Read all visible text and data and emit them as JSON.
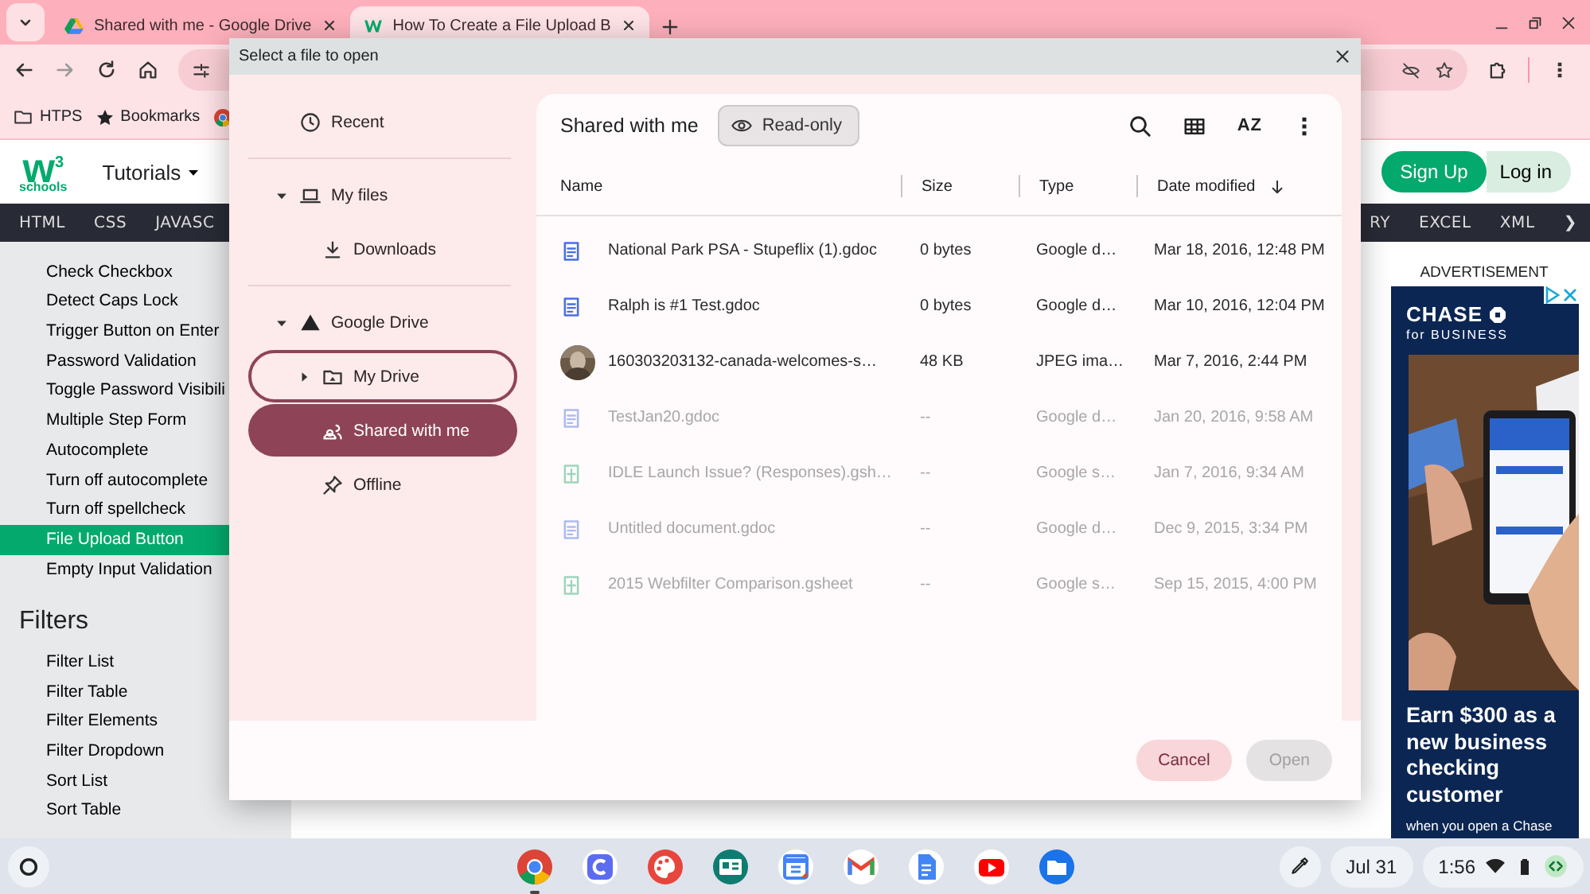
{
  "browser": {
    "tabs": [
      {
        "title": "Shared with me - Google Drive",
        "selected": false,
        "kind": "drive"
      },
      {
        "title": "How To Create a File Upload B",
        "selected": true,
        "kind": "w3"
      }
    ],
    "bookmarks": [
      {
        "label": "HTPS",
        "kind": "folder"
      },
      {
        "label": "Bookmarks",
        "kind": "star"
      }
    ]
  },
  "site": {
    "logo": {
      "mark": "w",
      "sup": "3",
      "text": "schools"
    },
    "menu": "Tutorials",
    "sign_up": "Sign Up",
    "log_in": "Log in",
    "nav_left": [
      "HTML",
      "CSS",
      "JAVASC"
    ],
    "nav_right": [
      "RY",
      "EXCEL",
      "XML",
      "❯"
    ],
    "sidebar": [
      {
        "label": "Check Checkbox",
        "selected": false
      },
      {
        "label": "Detect Caps Lock",
        "selected": false
      },
      {
        "label": "Trigger Button on Enter",
        "selected": false
      },
      {
        "label": "Password Validation",
        "selected": false
      },
      {
        "label": "Toggle Password Visibili",
        "selected": false
      },
      {
        "label": "Multiple Step Form",
        "selected": false
      },
      {
        "label": "Autocomplete",
        "selected": false
      },
      {
        "label": "Turn off autocomplete",
        "selected": false
      },
      {
        "label": "Turn off spellcheck",
        "selected": false
      },
      {
        "label": "File Upload Button",
        "selected": true
      },
      {
        "label": "Empty Input Validation",
        "selected": false
      }
    ],
    "filters": {
      "title": "Filters",
      "items": [
        {
          "label": "Filter List",
          "selected": false
        },
        {
          "label": "Filter Table",
          "selected": false
        },
        {
          "label": "Filter Elements",
          "selected": false
        },
        {
          "label": "Filter Dropdown",
          "selected": false
        },
        {
          "label": "Sort List",
          "selected": false
        },
        {
          "label": "Sort Table",
          "selected": false
        }
      ]
    },
    "ad": {
      "label": "ADVERTISEMENT",
      "brand": "CHASE",
      "sub": "for BUSINESS",
      "headline": "Earn $300 as a new business checking customer",
      "note": "when you open a Chase"
    }
  },
  "dialog": {
    "title": "Select a file to open",
    "nav": [
      {
        "label": "Recent",
        "kind": "recent",
        "selected": false,
        "focused": false
      },
      {
        "label": "My files",
        "kind": "device",
        "selected": false,
        "focused": false,
        "expanded": true,
        "children": [
          {
            "label": "Downloads",
            "kind": "downloads",
            "selected": false,
            "focused": false
          }
        ]
      },
      {
        "label": "Google Drive",
        "kind": "drive",
        "selected": false,
        "focused": false,
        "expanded": true,
        "children": [
          {
            "label": "My Drive",
            "kind": "my-drive",
            "selected": false,
            "focused": true,
            "expanded": false
          },
          {
            "label": "Shared with me",
            "kind": "shared",
            "selected": true,
            "focused": false
          },
          {
            "label": "Offline",
            "kind": "offline",
            "selected": false,
            "focused": false
          }
        ]
      }
    ],
    "location": "Shared with me",
    "badge": "Read-only",
    "sort_label": "AZ",
    "columns": [
      {
        "label": "Name",
        "sorted": false
      },
      {
        "label": "Size",
        "sorted": false
      },
      {
        "label": "Type",
        "sorted": false
      },
      {
        "label": "Date modified",
        "sorted": true
      }
    ],
    "files": [
      {
        "kind": "doc",
        "name": "National Park PSA - Stupeflix (1).gdoc",
        "size": "0 bytes",
        "type": "Google d…",
        "date": "Mar 18, 2016, 12:48 PM",
        "disabled": false
      },
      {
        "kind": "doc",
        "name": "Ralph is #1 Test.gdoc",
        "size": "0 bytes",
        "type": "Google d…",
        "date": "Mar 10, 2016, 12:04 PM",
        "disabled": false
      },
      {
        "name": "160303203132-canada-welcomes-s…",
        "size": "48 KB",
        "type": "JPEG ima…",
        "date": "Mar 7, 2016, 2:44 PM",
        "disabled": false
      },
      {
        "kind": "doc",
        "name": "TestJan20.gdoc",
        "size": "--",
        "type": "Google d…",
        "date": "Jan 20, 2016, 9:58 AM",
        "disabled": true
      },
      {
        "kind": "sheet",
        "name": "IDLE Launch Issue? (Responses).gsh…",
        "size": "--",
        "type": "Google s…",
        "date": "Jan 7, 2016, 9:34 AM",
        "disabled": true
      },
      {
        "kind": "doc",
        "name": "Untitled document.gdoc",
        "size": "--",
        "type": "Google d…",
        "date": "Dec 9, 2015, 3:34 PM",
        "disabled": true
      },
      {
        "kind": "sheet",
        "name": "2015 Webfilter Comparison.gsheet",
        "size": "--",
        "type": "Google s…",
        "date": "Sep 15, 2015, 4:00 PM",
        "disabled": true
      }
    ],
    "buttons": [
      {
        "label": "Cancel",
        "disabled": false
      },
      {
        "label": "Open",
        "disabled": true
      }
    ]
  },
  "taskbar": {
    "apps": [
      {
        "kind": "chrome",
        "running": true
      },
      {
        "kind": "canva",
        "running": false
      },
      {
        "kind": "palette",
        "running": false
      },
      {
        "kind": "classroom",
        "running": false
      },
      {
        "kind": "calendar",
        "running": false
      },
      {
        "kind": "gmail",
        "running": false
      },
      {
        "kind": "docs",
        "running": false
      },
      {
        "kind": "youtube",
        "running": false
      },
      {
        "kind": "files",
        "running": false
      }
    ],
    "date": "Jul 31",
    "time": "1:56"
  }
}
